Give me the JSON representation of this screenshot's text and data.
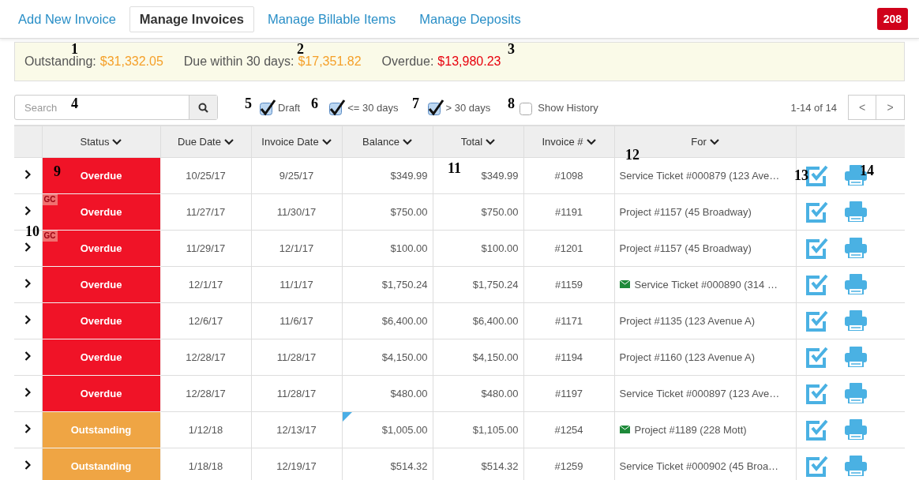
{
  "nav": {
    "tabs": [
      {
        "label": "Add New Invoice",
        "selected": false
      },
      {
        "label": "Manage Invoices",
        "selected": true
      },
      {
        "label": "Manage Billable Items",
        "selected": false
      },
      {
        "label": "Manage Deposits",
        "selected": false
      }
    ],
    "badge": "208"
  },
  "summary": [
    {
      "label": "Outstanding:",
      "amount": "$31,332.05",
      "kind": "outstanding"
    },
    {
      "label": "Due within 30 days:",
      "amount": "$17,351.82",
      "kind": "outstanding"
    },
    {
      "label": "Overdue:",
      "amount": "$13,980.23",
      "kind": "overdue"
    }
  ],
  "search": {
    "placeholder": "Search"
  },
  "filters": [
    {
      "label": "Draft",
      "checked": true
    },
    {
      "label": "<= 30 days",
      "checked": true
    },
    {
      "label": "> 30 days",
      "checked": true
    },
    {
      "label": "Show History",
      "checked": false
    }
  ],
  "pagination": {
    "range": "1-14 of 14",
    "prev": "<",
    "next": ">"
  },
  "table": {
    "columns": [
      "Status",
      "Due Date",
      "Invoice Date",
      "Balance",
      "Total",
      "Invoice #",
      "For"
    ],
    "rows": [
      {
        "status": "Overdue",
        "kind": "overdue",
        "tag": "",
        "due": "10/25/17",
        "invoice_date": "9/25/17",
        "balance": "$349.99",
        "note": false,
        "total": "$349.99",
        "number": "#1098",
        "emailed": false,
        "for": "Service Ticket #000879 (123 Ave…"
      },
      {
        "status": "Overdue",
        "kind": "overdue",
        "tag": "GC",
        "due": "11/27/17",
        "invoice_date": "11/30/17",
        "balance": "$750.00",
        "note": false,
        "total": "$750.00",
        "number": "#1191",
        "emailed": false,
        "for": "Project #1157 (45 Broadway)"
      },
      {
        "status": "Overdue",
        "kind": "overdue",
        "tag": "GC",
        "due": "11/29/17",
        "invoice_date": "12/1/17",
        "balance": "$100.00",
        "note": false,
        "total": "$100.00",
        "number": "#1201",
        "emailed": false,
        "for": "Project #1157 (45 Broadway)"
      },
      {
        "status": "Overdue",
        "kind": "overdue",
        "tag": "",
        "due": "12/1/17",
        "invoice_date": "11/1/17",
        "balance": "$1,750.24",
        "note": false,
        "total": "$1,750.24",
        "number": "#1159",
        "emailed": true,
        "for": "Service Ticket #000890 (314 …"
      },
      {
        "status": "Overdue",
        "kind": "overdue",
        "tag": "",
        "due": "12/6/17",
        "invoice_date": "11/6/17",
        "balance": "$6,400.00",
        "note": false,
        "total": "$6,400.00",
        "number": "#1171",
        "emailed": false,
        "for": "Project #1135 (123 Avenue A)"
      },
      {
        "status": "Overdue",
        "kind": "overdue",
        "tag": "",
        "due": "12/28/17",
        "invoice_date": "11/28/17",
        "balance": "$4,150.00",
        "note": false,
        "total": "$4,150.00",
        "number": "#1194",
        "emailed": false,
        "for": "Project #1160 (123 Avenue A)"
      },
      {
        "status": "Overdue",
        "kind": "overdue",
        "tag": "",
        "due": "12/28/17",
        "invoice_date": "11/28/17",
        "balance": "$480.00",
        "note": false,
        "total": "$480.00",
        "number": "#1197",
        "emailed": false,
        "for": "Service Ticket #000897 (123 Ave…"
      },
      {
        "status": "Outstanding",
        "kind": "outstanding",
        "tag": "",
        "due": "1/12/18",
        "invoice_date": "12/13/17",
        "balance": "$1,005.00",
        "note": true,
        "total": "$1,105.00",
        "number": "#1254",
        "emailed": true,
        "for": "Project #1189 (228 Mott)"
      },
      {
        "status": "Outstanding",
        "kind": "outstanding",
        "tag": "",
        "due": "1/18/18",
        "invoice_date": "12/19/17",
        "balance": "$514.32",
        "note": false,
        "total": "$514.32",
        "number": "#1259",
        "emailed": false,
        "for": "Service Ticket #000902 (45 Broa…"
      }
    ]
  },
  "annotations": [
    {
      "label": "1"
    },
    {
      "label": "2"
    },
    {
      "label": "3"
    },
    {
      "label": "4"
    },
    {
      "label": "5"
    },
    {
      "label": "6"
    },
    {
      "label": "7"
    },
    {
      "label": "8"
    },
    {
      "label": "9"
    },
    {
      "label": "10"
    },
    {
      "label": "11"
    },
    {
      "label": "12"
    },
    {
      "label": "13"
    },
    {
      "label": "14"
    }
  ]
}
